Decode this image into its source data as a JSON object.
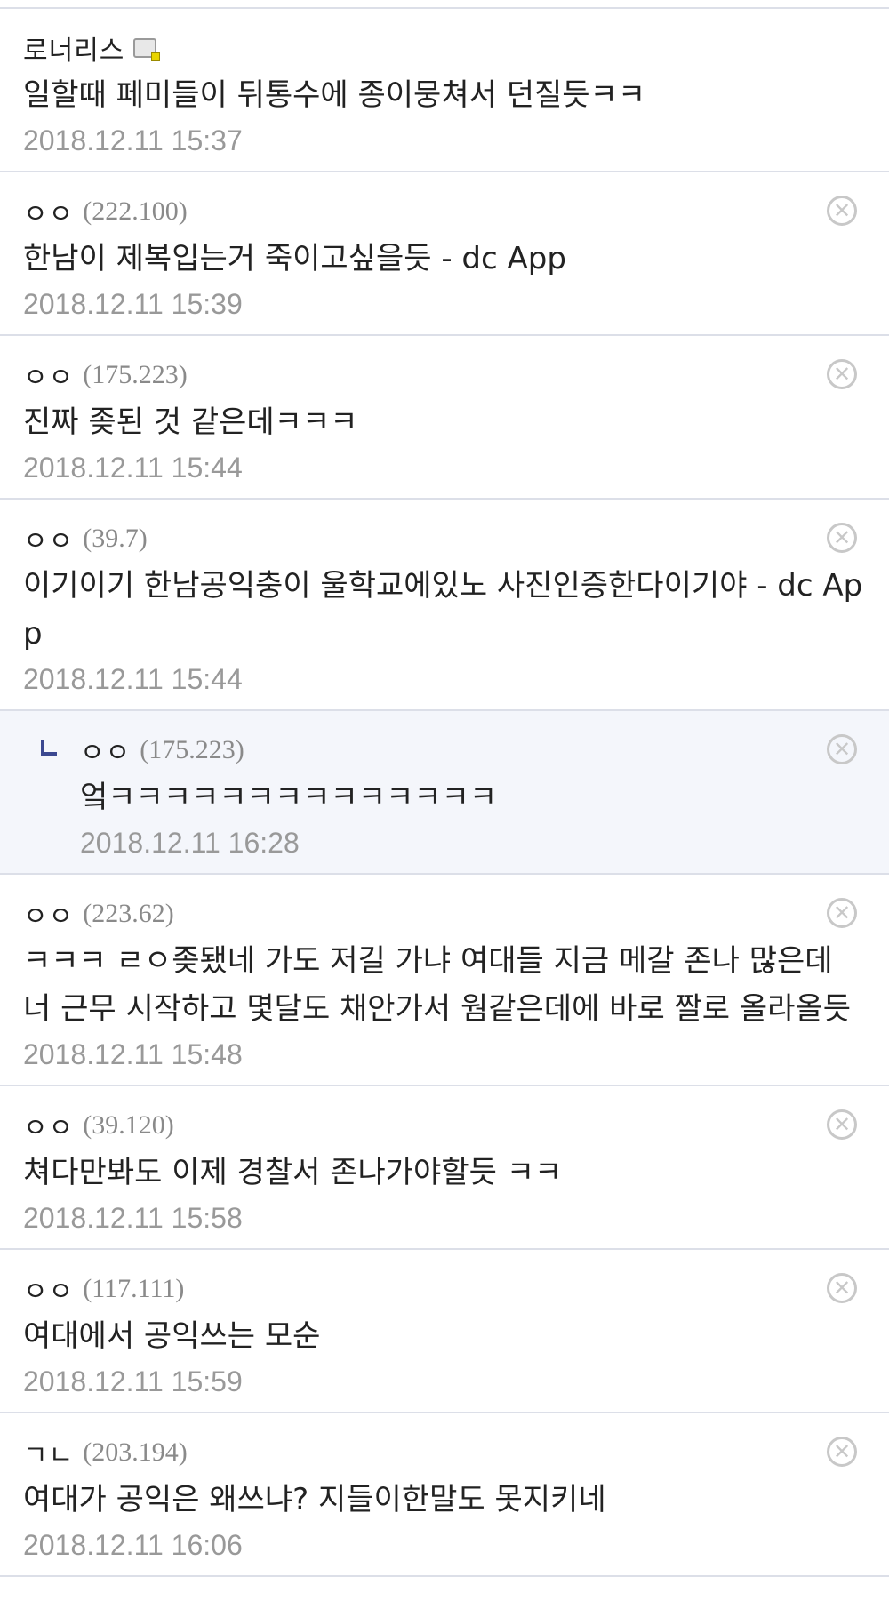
{
  "comments": [
    {
      "nick": "로너리스",
      "ip": "",
      "has_gallog_icon": true,
      "body": "일할때 페미들이 뒤통수에 종이뭉쳐서 던질듯ㅋㅋ",
      "date": "2018.12.11 15:37",
      "reply": false,
      "deletable": false
    },
    {
      "nick": "ㅇㅇ",
      "ip": "(222.100)",
      "body": "한남이 제복입는거 죽이고싶을듯 - dc App",
      "date": "2018.12.11 15:39",
      "reply": false,
      "deletable": true
    },
    {
      "nick": "ㅇㅇ",
      "ip": "(175.223)",
      "body": "진짜 좆된 것 같은데ㅋㅋㅋ",
      "date": "2018.12.11 15:44",
      "reply": false,
      "deletable": true
    },
    {
      "nick": "ㅇㅇ",
      "ip": "(39.7)",
      "body": "이기이기 한남공익충이 울학교에있노 사진인증한다이기야 - dc App",
      "date": "2018.12.11 15:44",
      "reply": false,
      "deletable": true
    },
    {
      "nick": "ㅇㅇ",
      "ip": "(175.223)",
      "body": "엌ㅋㅋㅋㅋㅋㅋㅋㅋㅋㅋㅋㅋㅋㅋ",
      "date": "2018.12.11 16:28",
      "reply": true,
      "deletable": true
    },
    {
      "nick": "ㅇㅇ",
      "ip": "(223.62)",
      "body": "ㅋㅋㅋ ㄹㅇ좆됐네 가도 저길 가냐 여대들 지금 메갈 존나 많은데 너 근무 시작하고 몇달도 채안가서 웜같은데에 바로 짤로 올라올듯",
      "date": "2018.12.11 15:48",
      "reply": false,
      "deletable": true
    },
    {
      "nick": "ㅇㅇ",
      "ip": "(39.120)",
      "body": "쳐다만봐도 이제 경찰서 존나가야할듯 ㅋㅋ",
      "date": "2018.12.11 15:58",
      "reply": false,
      "deletable": true
    },
    {
      "nick": "ㅇㅇ",
      "ip": "(117.111)",
      "body": "여대에서 공익쓰는 모순",
      "date": "2018.12.11 15:59",
      "reply": false,
      "deletable": true
    },
    {
      "nick": "ㄱㄴ",
      "ip": "(203.194)",
      "body": "여대가 공익은 왜쓰냐? 지들이한말도 못지키네",
      "date": "2018.12.11 16:06",
      "reply": false,
      "deletable": true
    }
  ],
  "delete_icon_glyph": "✕",
  "colors": {
    "divider": "#dcdfe8",
    "reply_bg": "#f4f6fb",
    "reply_mark": "#3b4890",
    "date": "#999999",
    "ip": "#8a8a8a"
  }
}
